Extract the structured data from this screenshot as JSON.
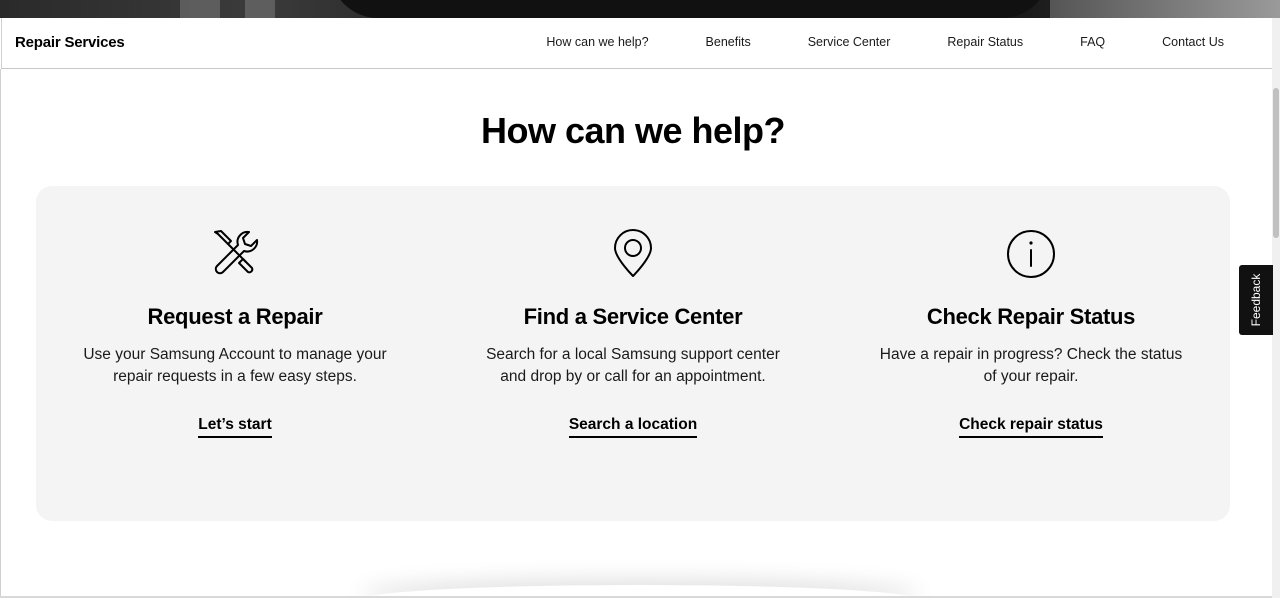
{
  "header": {
    "brand": "Repair Services",
    "nav": [
      {
        "label": "How can we help?"
      },
      {
        "label": "Benefits"
      },
      {
        "label": "Service Center"
      },
      {
        "label": "Repair Status"
      },
      {
        "label": "FAQ"
      },
      {
        "label": "Contact Us"
      }
    ]
  },
  "main": {
    "title": "How can we help?",
    "cards": [
      {
        "icon": "tools-icon",
        "title": "Request a Repair",
        "description": "Use your Samsung Account to manage your repair requests in a few easy steps.",
        "link": "Let’s start"
      },
      {
        "icon": "location-pin-icon",
        "title": "Find a Service Center",
        "description": "Search for a local Samsung support center and drop by or call for an appointment.",
        "link": "Search a location"
      },
      {
        "icon": "info-icon",
        "title": "Check Repair Status",
        "description": "Have a repair in progress? Check the status of your repair.",
        "link": "Check repair status"
      }
    ]
  },
  "feedback": {
    "label": "Feedback"
  },
  "colors": {
    "card_background": "#f4f4f4",
    "text": "#000000",
    "feedback_bg": "#111111"
  }
}
